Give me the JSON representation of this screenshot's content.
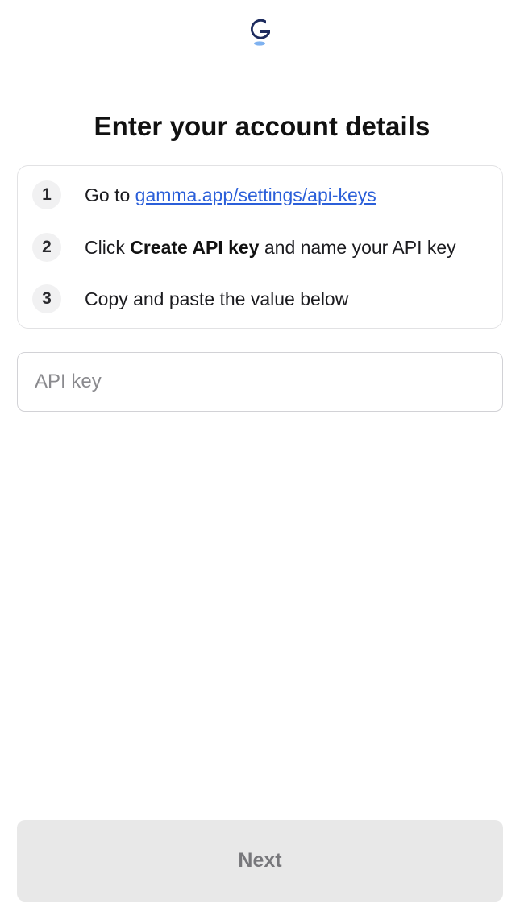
{
  "brand": {
    "logo_icon": "gamma-logo-icon",
    "colors": {
      "logo_dark": "#1d2b5e",
      "logo_accent": "#7fb2f0"
    }
  },
  "title": "Enter your account details",
  "steps": [
    {
      "number": "1",
      "prefix": "Go to ",
      "link": "gamma.app/settings/api-keys"
    },
    {
      "number": "2",
      "prefix": "Click ",
      "bold": "Create API key",
      "suffix": " and name your API key"
    },
    {
      "number": "3",
      "text": "Copy and paste the value below"
    }
  ],
  "api_key": {
    "placeholder": "API key",
    "value": ""
  },
  "next_label": "Next",
  "colors": {
    "link": "#2b5fd9",
    "button_bg": "#e8e8e8",
    "button_text": "#77777b"
  }
}
